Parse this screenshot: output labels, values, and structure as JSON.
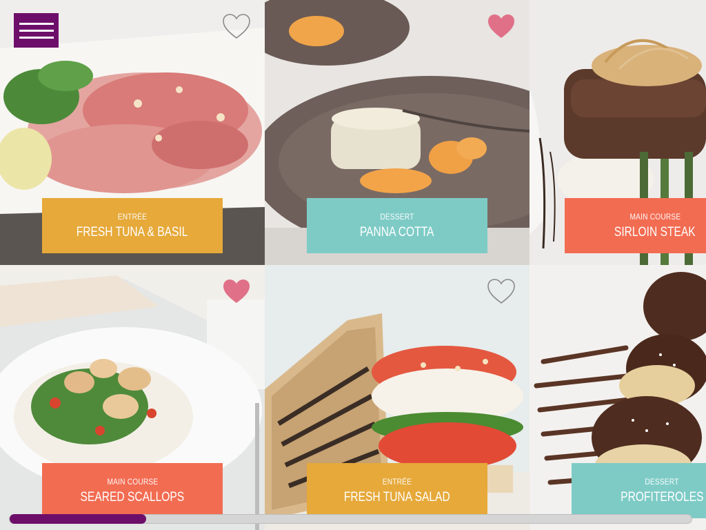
{
  "menu": {
    "icon": "hamburger-menu-icon"
  },
  "recipes": [
    {
      "course": "ENTRÉE",
      "title": "FRESH TUNA & BASIL",
      "label_color": "#e6a93a",
      "favorite": false
    },
    {
      "course": "DESSERT",
      "title": "PANNA COTTA",
      "label_color": "#7ecbc6",
      "favorite": true
    },
    {
      "course": "MAIN COURSE",
      "title": "SIRLOIN STEAK",
      "label_color": "#f26c52",
      "favorite": null
    },
    {
      "course": "MAIN COURSE",
      "title": "SEARED SCALLOPS",
      "label_color": "#f26c52",
      "favorite": true
    },
    {
      "course": "ENTRÉE",
      "title": "FRESH TUNA SALAD",
      "label_color": "#e6a93a",
      "favorite": false
    },
    {
      "course": "DESSERT",
      "title": "PROFITEROLES",
      "label_color": "#7ecbc6",
      "favorite": null
    }
  ],
  "colors": {
    "accent": "#6d0f6a",
    "heart_filled": "#e07088",
    "heart_outline": "#8a8a8a"
  },
  "scroll": {
    "progress": 0.2
  }
}
